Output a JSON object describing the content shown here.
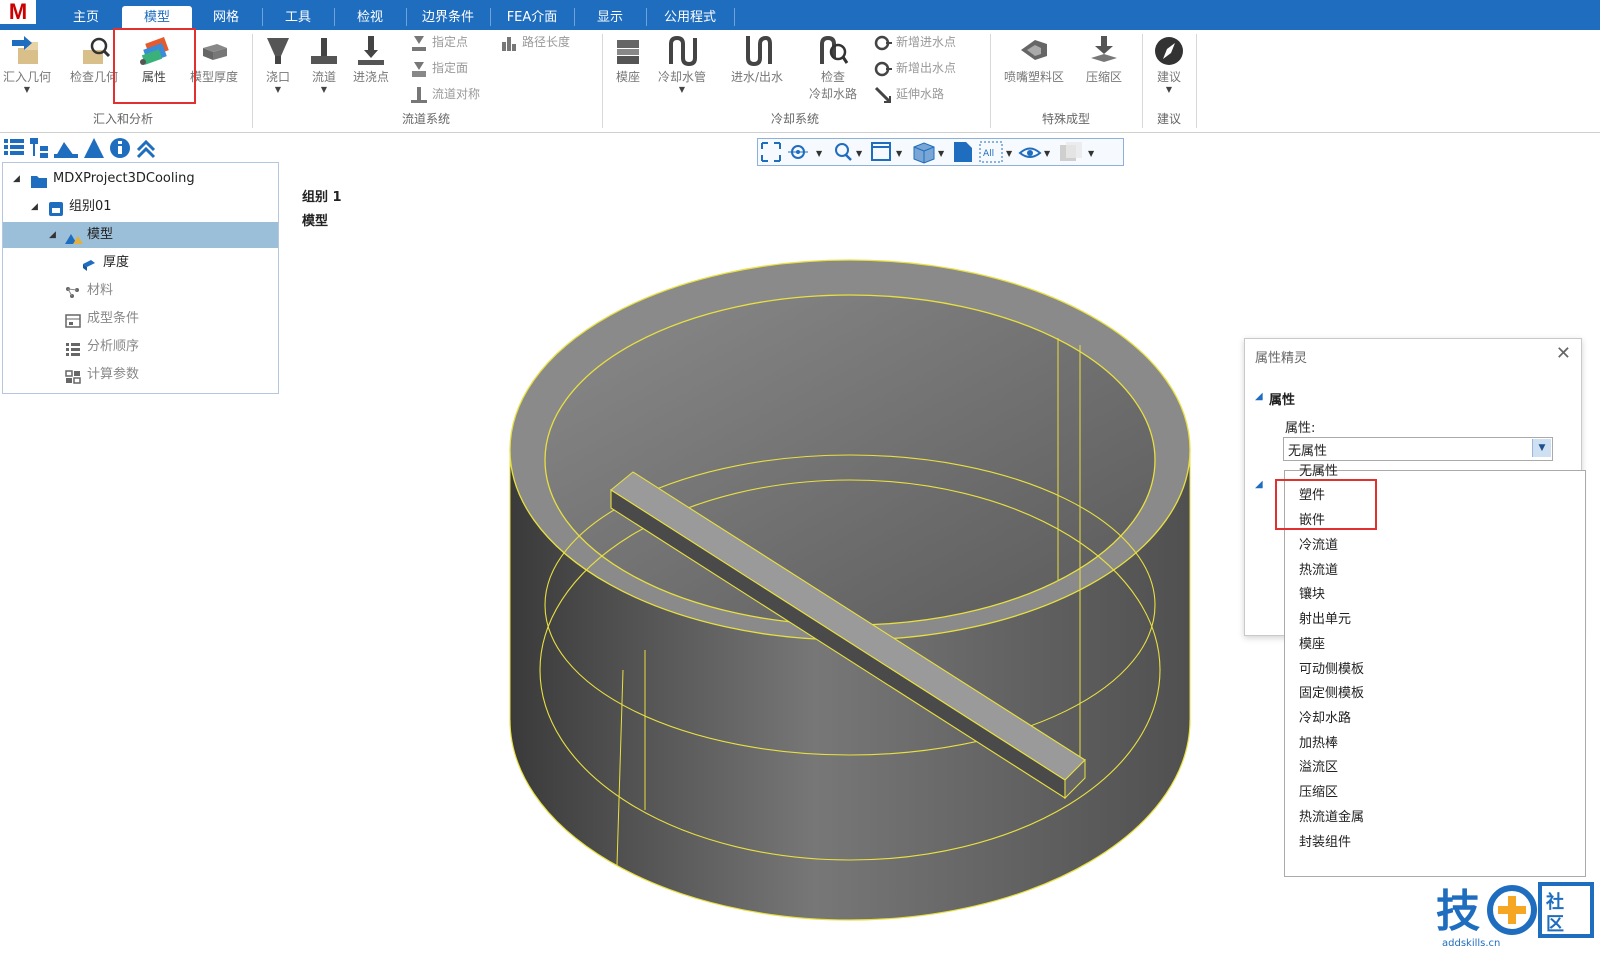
{
  "app": {
    "logo": "M"
  },
  "tabs": [
    {
      "label": "主页"
    },
    {
      "label": "模型"
    },
    {
      "label": "网格"
    },
    {
      "label": "工具"
    },
    {
      "label": "检视"
    },
    {
      "label": "边界条件"
    },
    {
      "label": "FEA介面"
    },
    {
      "label": "显示"
    },
    {
      "label": "公用程式"
    }
  ],
  "ribbon": {
    "import_geometry": "汇入几何",
    "check_geometry": "检查几何",
    "attribute": "属性",
    "model_thickness": "模型厚度",
    "group_import_analysis": "汇入和分析",
    "gate": "浇口",
    "runner": "流道",
    "injection_point": "进浇点",
    "assign_point": "指定点",
    "assign_face": "指定面",
    "runner_symmetry": "流道对称",
    "path_length": "路径长度",
    "group_runner_system": "流道系统",
    "mold_base": "模座",
    "cooling_pipe": "冷却水管",
    "inlet_outlet": "进水/出水",
    "check_cooling": "检查\n冷却水路",
    "check_line1": "检查",
    "check_line2": "冷却水路",
    "add_inlet": "新增进水点",
    "add_outlet": "新增出水点",
    "extend_channel": "延伸水路",
    "group_cooling": "冷却系统",
    "nozzle_area": "喷嘴塑料区",
    "compression_area": "压缩区",
    "group_special": "特殊成型",
    "advice": "建议",
    "group_advice": "建议"
  },
  "tree": {
    "items": [
      {
        "label": "MDXProject3DCooling"
      },
      {
        "label": "组别01"
      },
      {
        "label": "模型"
      },
      {
        "label": "厚度"
      },
      {
        "label": "材料"
      },
      {
        "label": "成型条件"
      },
      {
        "label": "分析顺序"
      },
      {
        "label": "计算参数"
      }
    ]
  },
  "viewtoolbar": {
    "all_label": "All"
  },
  "canvas": {
    "group_label": "组别 1",
    "model_label": "模型"
  },
  "dialog": {
    "title": "属性精灵",
    "section": "属性",
    "property_label": "属性:",
    "selected": "无属性",
    "options": [
      "无属性",
      "塑件",
      "嵌件",
      "冷流道",
      "热流道",
      "镶块",
      "射出单元",
      "模座",
      "可动侧模板",
      "固定侧模板",
      "冷却水路",
      "加热棒",
      "溢流区",
      "压缩区",
      "热流道金属",
      "封装组件"
    ]
  },
  "watermark": {
    "brand": "技",
    "side": "社区",
    "url": "addskills.cn"
  },
  "colors": {
    "accent": "#1f6dbf",
    "highlight": "#e03030",
    "model_edge": "#e8e040",
    "tree_selected": "#9cbfd9"
  }
}
